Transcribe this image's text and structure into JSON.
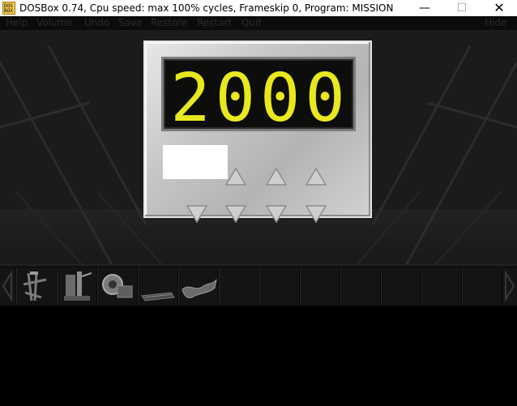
{
  "window": {
    "title": "DOSBox 0.74, Cpu speed: max 100% cycles, Frameskip  0, Program:  MISSION",
    "icon": "dosbox-icon",
    "icon_text": "DOS BOX",
    "minimize_glyph": "—",
    "maximize_glyph": "☐",
    "close_glyph": "✕"
  },
  "menu": {
    "items": [
      "Help",
      "Volume",
      "Undo",
      "Save",
      "Restore",
      "Restart",
      "Quit"
    ],
    "right_item": "Hide"
  },
  "panel": {
    "display_value": "2000",
    "display_color": "#e8e820",
    "up_buttons": 3,
    "down_buttons": 4
  },
  "inventory": {
    "slots": [
      "pipe-tool-icon",
      "machinery-icon",
      "gear-device-icon",
      "book-icon",
      "cloth-icon",
      "",
      "",
      "",
      "",
      "",
      "",
      ""
    ]
  }
}
